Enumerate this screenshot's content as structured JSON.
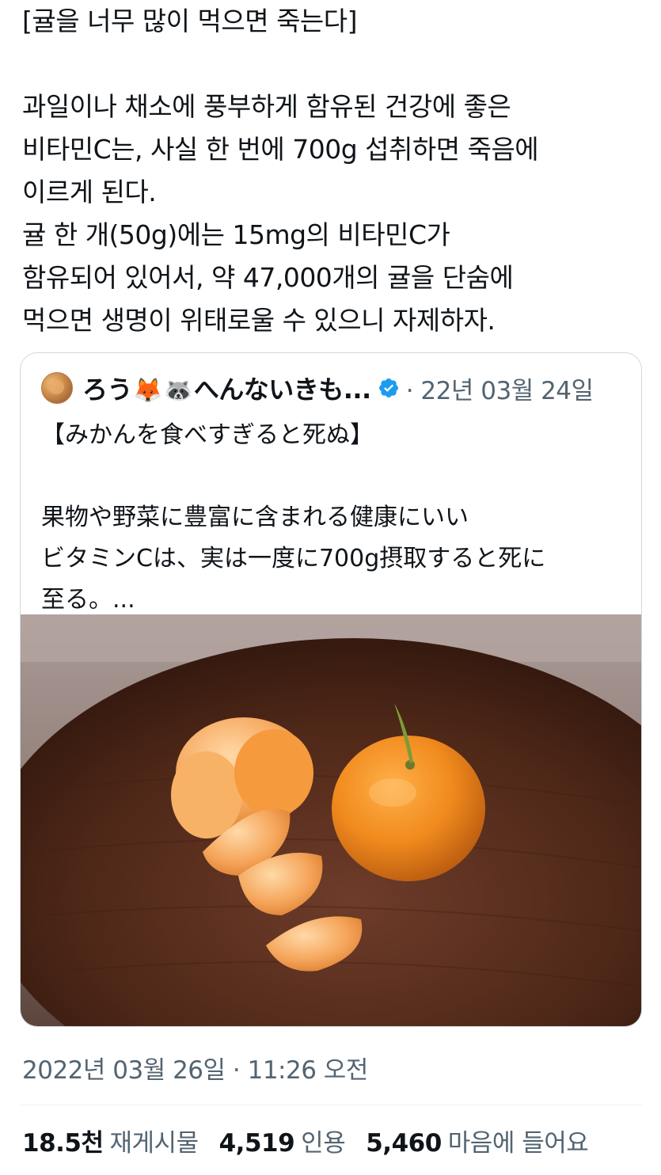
{
  "tweet": {
    "lines": [
      "[귤을 너무 많이 먹으면 죽는다]",
      "",
      "과일이나 채소에 풍부하게 함유된 건강에 좋은",
      "비타민C는, 사실 한 번에 700g 섭취하면 죽음에",
      "이르게 된다.",
      "귤 한 개(50g)에는 15mg의 비타민C가",
      "함유되어 있어서, 약 47,000개의 귤을 단숨에",
      "먹으면 생명이 위태로울 수 있으니 자제하자."
    ],
    "timestamp": "2022년 03월 26일 · 11:26 오전"
  },
  "quote": {
    "name_text_1": "ろう",
    "emoji_1": "🦊",
    "emoji_2": "🦝",
    "name_text_2": "へんないきも...",
    "meta": "· 22년 03월 24일",
    "lines": [
      "【みかんを食べすぎると死ぬ】",
      "",
      "果物や野菜に豊富に含まれる健康にいい",
      "ビタミンCは、実は一度に700g摂取すると死に",
      "至る。..."
    ]
  },
  "stats": {
    "retweets_count": "18.5천",
    "retweets_label": "재게시물",
    "quotes_count": "4,519",
    "quotes_label": "인용",
    "likes_count": "5,460",
    "likes_label": "마음에 들어요"
  },
  "colors": {
    "text": "#0f1419",
    "secondary": "#536471",
    "verified": "#1d9bf0",
    "border": "#cfd9de"
  }
}
